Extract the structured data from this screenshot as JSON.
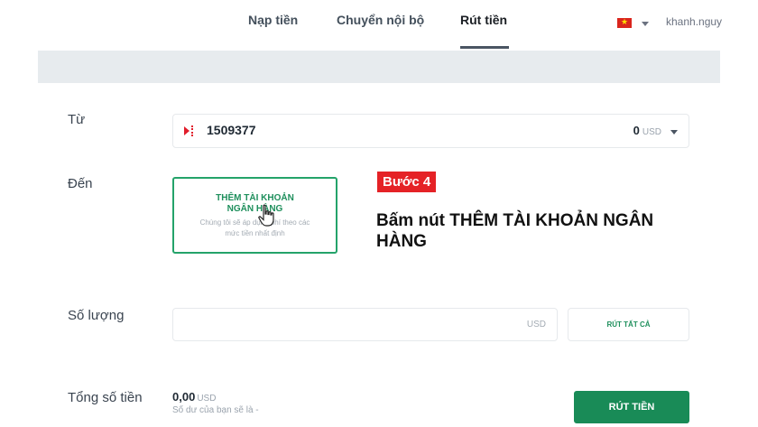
{
  "nav": {
    "tabs": [
      {
        "label": "Nạp tiền"
      },
      {
        "label": "Chuyển nội bộ"
      },
      {
        "label": "Rút tiền"
      }
    ],
    "active_tab": "Rút tiền",
    "user": "khanh.nguy",
    "flag_icon": "vietnam-flag-icon"
  },
  "form": {
    "from_label": "Từ",
    "from_account": "1509377",
    "from_balance": "0",
    "from_currency": "USD",
    "to_label": "Đến",
    "add_bank_title": "THÊM TÀI KHOẢN NGÂN HÀNG",
    "add_bank_subtitle": "Chúng tôi sẽ áp dụng phí theo các mức tiền nhất định",
    "amount_label": "Số lượng",
    "amount_value": "",
    "amount_currency": "USD",
    "withdraw_all_label": "RÚT TẤT CẢ",
    "total_label": "Tổng số tiền",
    "total_value": "0,00",
    "total_currency": "USD",
    "balance_note": "Số dư của bạn sẽ là -",
    "withdraw_button_label": "RÚT TIỀN"
  },
  "annotation": {
    "step_badge": "Bước 4",
    "step_text": "Bấm nút THÊM TÀI KHOẢN NGÂN HÀNG"
  },
  "colors": {
    "accent_green": "#198b57",
    "badge_red": "#e52226"
  }
}
